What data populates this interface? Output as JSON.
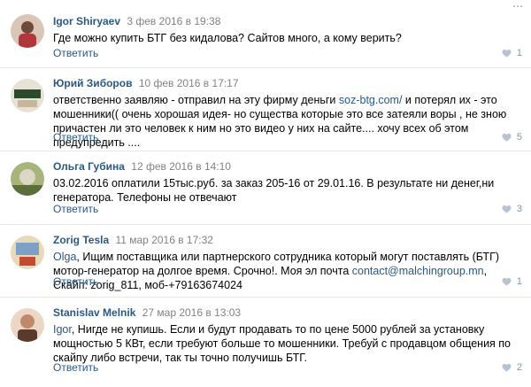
{
  "top_menu_glyph": "⋯",
  "reply_label": "Ответить",
  "comments": [
    {
      "author": "Igor Shiryaev",
      "date": "3 фев 2016 в 19:38",
      "text_parts": [
        "Где можно купить БТГ без кидалова? Сайтов много, а кому верить?"
      ],
      "likes": "1",
      "avatar_colors": [
        "#d9c6b7",
        "#b0383c",
        "#6e4a3a"
      ]
    },
    {
      "author": "Юрий Зиборов",
      "date": "10 фев 2016 в 17:17",
      "text_before": "ответственно заявляю - отправил на эту фирму деньги ",
      "link": "soz-btg.com/",
      "text_after": " и потерял их - это мошенники(( очень хорошая идея- но существа которые это все затеяли воры , не зною причастен ли это человек к ним но это видео у них на сайте.... хочу всех об этом предупредить ....",
      "likes": "5",
      "avatar_colors": [
        "#e6e2d6",
        "#2e4a2e",
        "#c8b69a"
      ]
    },
    {
      "author": "Ольга Губина",
      "date": "12 фев 2016 в 14:10",
      "text": "03.02.2016 оплатили 15тыс.руб. за заказ 205-16 от 29.01.16. В результате ни денег,ни генератора. Телефоны не отвечают",
      "likes": "3",
      "avatar_colors": [
        "#a7b47a",
        "#5c6e3b",
        "#dcd7c4"
      ]
    },
    {
      "author": "Zorig Tesla",
      "date": "11 мар 2016 в 17:32",
      "mention": "Olga",
      "text_before": ", Ищим поставщика или партнерского сотрудника который могут поставлять (БТГ) мотор-генератор на долгое время. Срочно!. Моя эл почта ",
      "link": "contact@malchingroup.mn",
      "text_after": ", Скайп: zorig_811, моб-+79163674024",
      "likes": "1",
      "avatar_colors": [
        "#e8d9b8",
        "#7ea0c7",
        "#c44a32"
      ]
    },
    {
      "author": "Stanislav Melnik",
      "date": "27 мар 2016 в 13:03",
      "mention": "Igor",
      "text_after": ", Нигде не купишь. Если и будут продавать то по цене 5000 рублей за установку мощностью 5 КВт, если требуют больше то мошенники. Требуй с продавцом общения по скайпу либо встречи, так ты точно получишь БТГ.",
      "likes": "2",
      "avatar_colors": [
        "#ecd6c5",
        "#c08a6a",
        "#5a3a2a"
      ]
    }
  ]
}
